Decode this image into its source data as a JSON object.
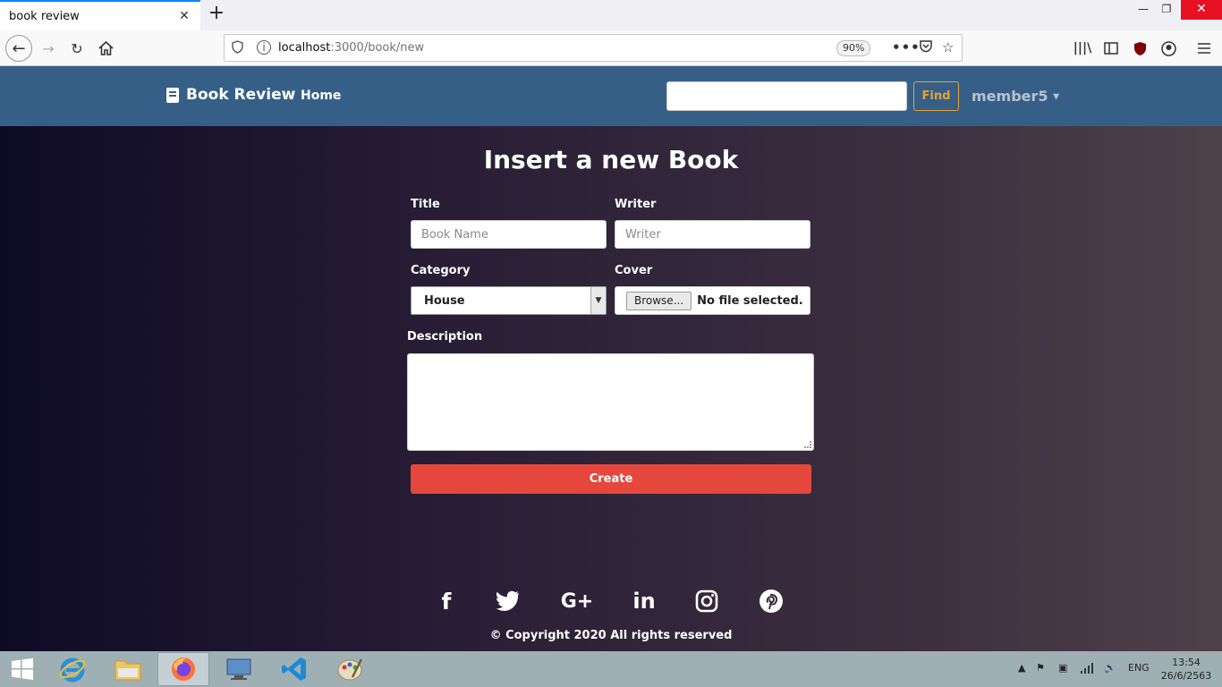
{
  "browser": {
    "tab_title": "book review",
    "tab_close": "✕",
    "new_tab": "+",
    "url_host": "localhost",
    "url_rest": ":3000/book/new",
    "zoom": "90%",
    "win_min": "—",
    "win_restore": "❐",
    "win_close": "✕"
  },
  "navbar": {
    "brand": "Book Review",
    "home": "Home",
    "search_value": "",
    "find": "Find",
    "user": "member5"
  },
  "form": {
    "heading": "Insert a new Book",
    "title_label": "Title",
    "title_placeholder": "Book Name",
    "writer_label": "Writer",
    "writer_placeholder": "Writer",
    "category_label": "Category",
    "category_value": "House",
    "cover_label": "Cover",
    "browse": "Browse...",
    "no_file": "No file selected.",
    "description_label": "Description",
    "create": "Create"
  },
  "footer": {
    "social_icons": [
      "facebook-icon",
      "twitter-icon",
      "google-plus-icon",
      "linkedin-icon",
      "instagram-icon",
      "pinterest-icon"
    ],
    "facebook": "f",
    "googleplus": "G+",
    "linkedin": "in",
    "copyright": "© Copyright 2020 All rights reserved"
  },
  "taskbar": {
    "lang": "ENG",
    "time": "13:54",
    "date": "26/6/2563"
  },
  "colors": {
    "navbar": "#365f87",
    "create_button": "#e5473d",
    "find_button": "#e5a23a"
  }
}
